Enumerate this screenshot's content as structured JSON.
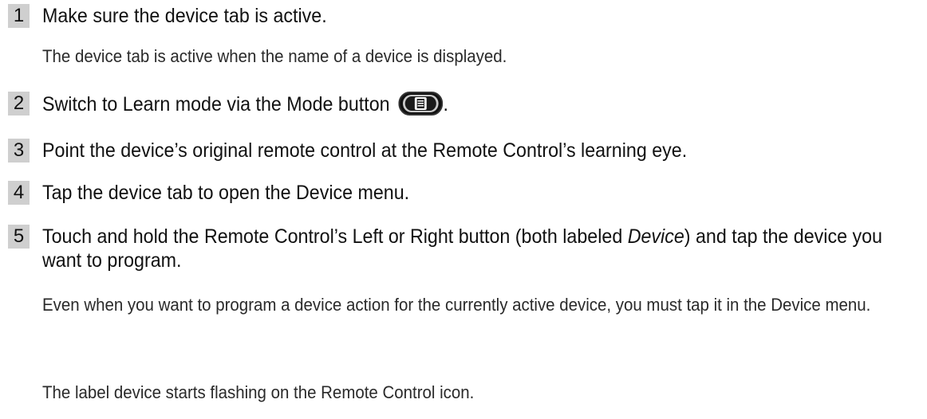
{
  "steps": [
    {
      "num": "1",
      "text": "Make sure the device tab is active."
    },
    {
      "num": "2",
      "text": "Switch to Learn mode via the Mode button",
      "suffix": "."
    },
    {
      "num": "3",
      "text": "Point the device’s original remote control at the Remote Control’s learning eye."
    },
    {
      "num": "4",
      "text": "Tap the device tab to open the Device menu."
    },
    {
      "num": "5",
      "text_before": "Touch and hold the Remote Control’s Left or Right button (both labeled ",
      "text_em": "Device",
      "text_after": ") and tap the device you want to program."
    }
  ],
  "notes": {
    "step1": "The device tab is active when the name of a device is displayed.",
    "step5_a": "Even when you want to program a device action for the currently active device, you must tap it in the Device menu.",
    "step5_b": "The label device starts flashing on the Remote Control icon."
  },
  "icons": {
    "mode_button": "mode-button-icon"
  }
}
